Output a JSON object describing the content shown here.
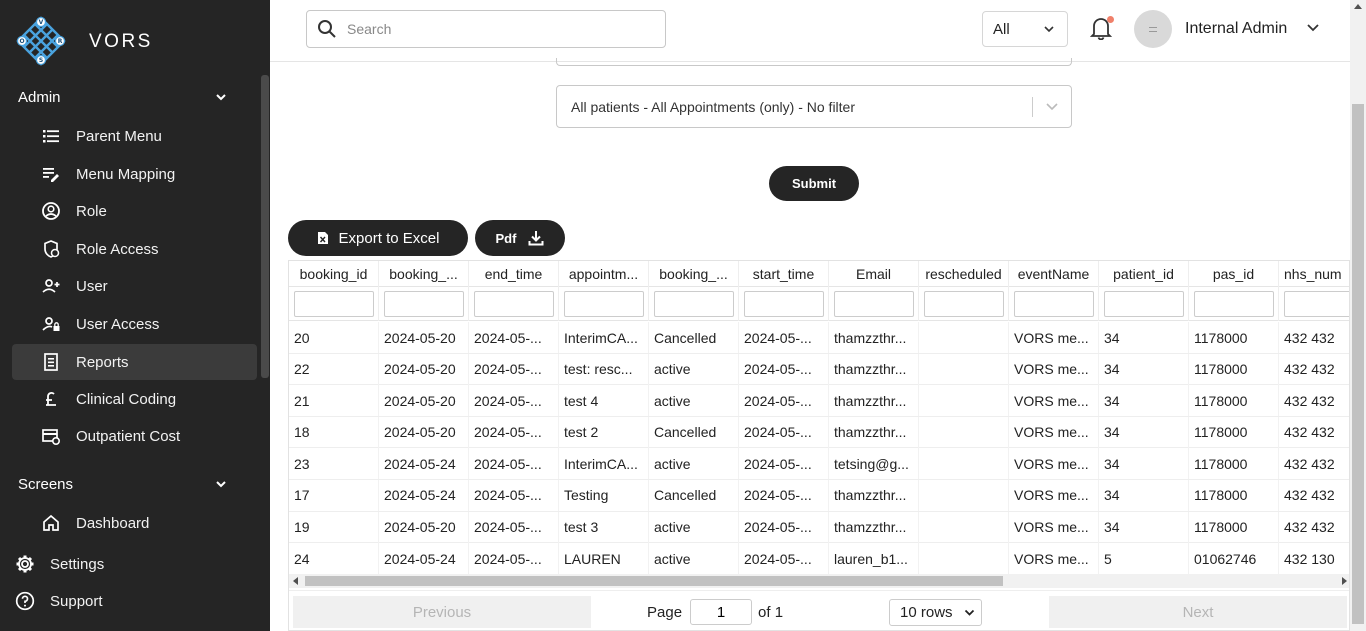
{
  "app": {
    "brand": "VORS",
    "logo_letters": [
      "V",
      "O",
      "R",
      "S"
    ]
  },
  "sidebar": {
    "sections": [
      {
        "title": "Admin",
        "items": [
          {
            "label": "Parent Menu",
            "icon": "list-icon"
          },
          {
            "label": "Menu Mapping",
            "icon": "edit-list-icon"
          },
          {
            "label": "Role",
            "icon": "account-circle-icon"
          },
          {
            "label": "Role Access",
            "icon": "shield-person-icon"
          },
          {
            "label": "User",
            "icon": "person-add-icon"
          },
          {
            "label": "User Access",
            "icon": "user-lock-icon"
          },
          {
            "label": "Reports",
            "icon": "report-icon",
            "active": true
          },
          {
            "label": "Clinical Coding",
            "icon": "pound-icon"
          },
          {
            "label": "Outpatient Cost",
            "icon": "card-settings-icon"
          }
        ]
      },
      {
        "title": "Screens",
        "items": [
          {
            "label": "Dashboard",
            "icon": "home-icon"
          }
        ]
      }
    ],
    "bottom": [
      {
        "label": "Settings",
        "icon": "gear-icon"
      },
      {
        "label": "Support",
        "icon": "help-icon"
      }
    ]
  },
  "header": {
    "search_placeholder": "Search",
    "filter_value": "All",
    "user_name": "Internal Admin",
    "notification_color": "#f0806a"
  },
  "main": {
    "patient_filter": "All patients - All Appointments (only) - No filter",
    "submit_label": "Submit",
    "export_excel_label": "Export to Excel",
    "pdf_label": "Pdf"
  },
  "table": {
    "columns": [
      "booking_id",
      "booking_...",
      "end_time",
      "appointm...",
      "booking_...",
      "start_time",
      "Email",
      "rescheduled",
      "eventName",
      "patient_id",
      "pas_id",
      "nhs_num"
    ],
    "rows": [
      [
        "20",
        "2024-05-20",
        "2024-05-...",
        "InterimCA...",
        "Cancelled",
        "2024-05-...",
        "thamzzthr...",
        "",
        "VORS me...",
        "34",
        "1178000",
        "432 432"
      ],
      [
        "22",
        "2024-05-20",
        "2024-05-...",
        "test: resc...",
        "active",
        "2024-05-...",
        "thamzzthr...",
        "",
        "VORS me...",
        "34",
        "1178000",
        "432 432"
      ],
      [
        "21",
        "2024-05-20",
        "2024-05-...",
        "test 4",
        "active",
        "2024-05-...",
        "thamzzthr...",
        "",
        "VORS me...",
        "34",
        "1178000",
        "432 432"
      ],
      [
        "18",
        "2024-05-20",
        "2024-05-...",
        "test 2",
        "Cancelled",
        "2024-05-...",
        "thamzzthr...",
        "",
        "VORS me...",
        "34",
        "1178000",
        "432 432"
      ],
      [
        "23",
        "2024-05-24",
        "2024-05-...",
        "InterimCA...",
        "active",
        "2024-05-...",
        "tetsing@g...",
        "",
        "VORS me...",
        "34",
        "1178000",
        "432 432"
      ],
      [
        "17",
        "2024-05-24",
        "2024-05-...",
        "Testing",
        "Cancelled",
        "2024-05-...",
        "thamzzthr...",
        "",
        "VORS me...",
        "34",
        "1178000",
        "432 432"
      ],
      [
        "19",
        "2024-05-20",
        "2024-05-...",
        "test 3",
        "active",
        "2024-05-...",
        "thamzzthr...",
        "",
        "VORS me...",
        "34",
        "1178000",
        "432 432"
      ],
      [
        "24",
        "2024-05-24",
        "2024-05-...",
        "LAUREN",
        "active",
        "2024-05-...",
        "lauren_b1...",
        "",
        "VORS me...",
        "5",
        "01062746",
        "432 130"
      ]
    ]
  },
  "pagination": {
    "previous_label": "Previous",
    "next_label": "Next",
    "page_label": "Page",
    "current_page": "1",
    "of_label": "of 1",
    "rows_option": "10 rows"
  }
}
